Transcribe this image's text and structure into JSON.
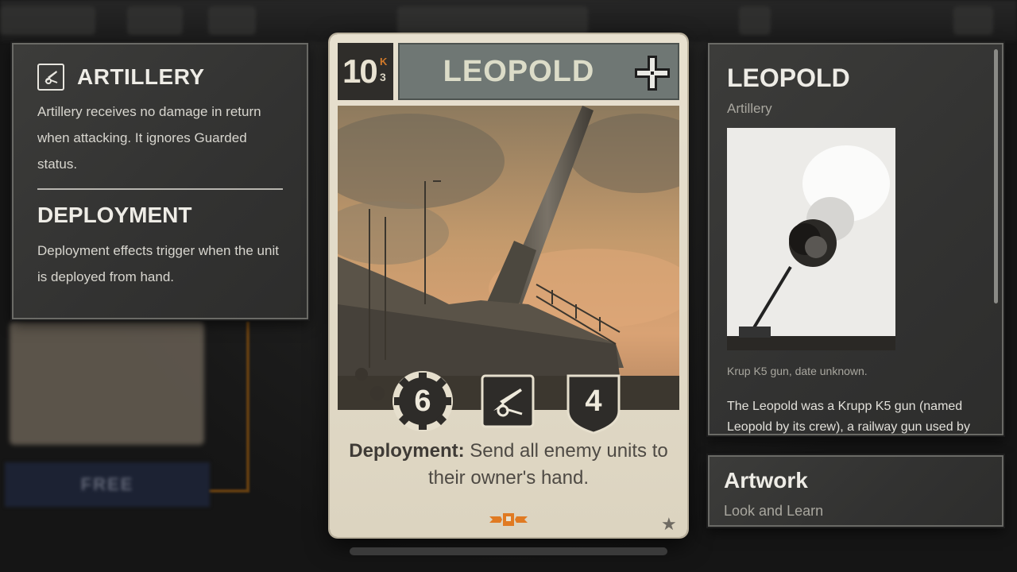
{
  "background": {
    "free_label": "FREE"
  },
  "keywords": {
    "artillery": {
      "icon": "artillery-icon",
      "title": "ARTILLERY",
      "text": "Artillery receives no damage in return when attacking. It ignores Guarded status."
    },
    "deployment": {
      "title": "DEPLOYMENT",
      "text": "Deployment effects trigger when the unit is deployed from hand."
    }
  },
  "card": {
    "cost": "10",
    "cost_k_label": "K",
    "cost_k_value": "3",
    "name": "LEOPOLD",
    "nation_icon": "iron-cross-icon",
    "attack": "6",
    "type_icon": "artillery-gun-icon",
    "defense": "4",
    "ability_keyword": "Deployment:",
    "ability_text": " Send all enemy units to their owner's hand.",
    "rarity_icon": "star-icon",
    "colors": {
      "cost_bg": "#2f2d2a",
      "name_bar": "#6f7774",
      "k_accent": "#d27a2a",
      "emblem": "#e07a22"
    }
  },
  "detail": {
    "name": "LEOPOLD",
    "type": "Artillery",
    "caption": "Krup K5 gun, date unknown.",
    "description": "The Leopold was a Krupp K5 gun (named Leopold by its crew), a railway gun used by"
  },
  "artwork": {
    "title": "Artwork",
    "credit": "Look and Learn"
  }
}
